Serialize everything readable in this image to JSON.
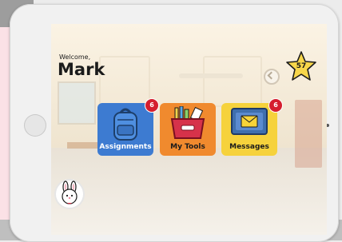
{
  "welcome": {
    "greeting": "Welcome,",
    "name": "Mark"
  },
  "stars": {
    "count": "57",
    "icon": "star-icon"
  },
  "tiles": [
    {
      "label": "Assignments",
      "badge": "6",
      "icon": "backpack-icon",
      "color": "#3d7bd1",
      "text_color": "#ffffff"
    },
    {
      "label": "My Tools",
      "badge": "",
      "icon": "toolbox-icon",
      "color": "#f08a2e",
      "text_color": "#1b1b1b"
    },
    {
      "label": "Messages",
      "badge": "6",
      "icon": "envelope-icon",
      "color": "#f6d23c",
      "text_color": "#1b1b1b"
    }
  ],
  "profile": {
    "icon": "bunny-avatar-icon"
  },
  "colors": {
    "badge": "#d51e2e",
    "screen_bg": "#f6efe2"
  }
}
